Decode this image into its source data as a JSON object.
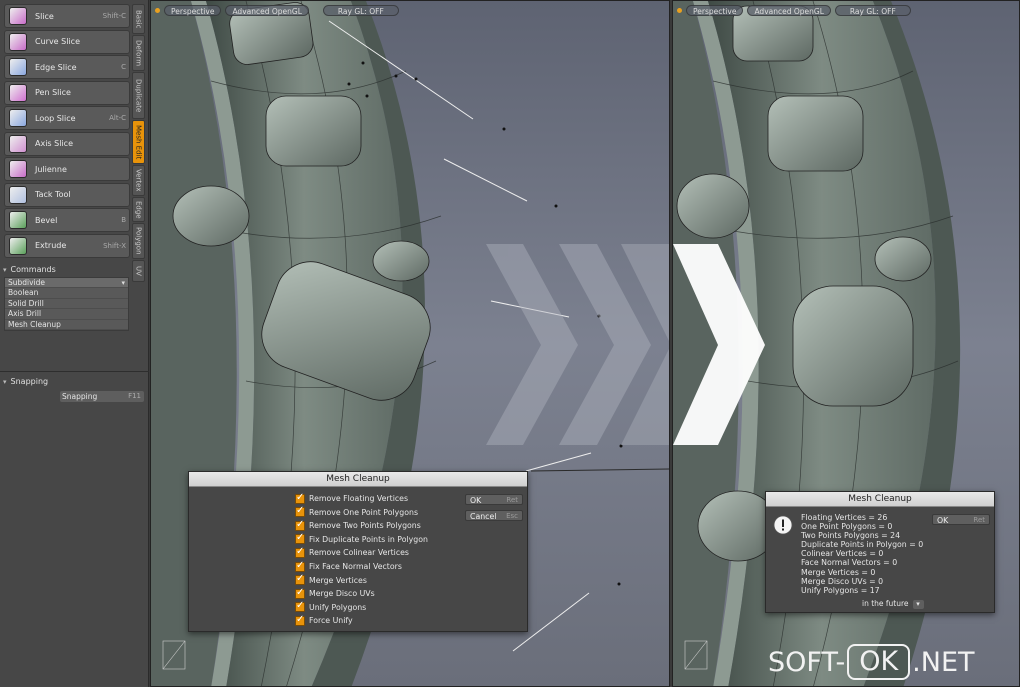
{
  "toolbar": {
    "tools": [
      {
        "label": "Slice",
        "shortcut": "Shift-C",
        "icon": "slice-icon",
        "color": "#c86cc8"
      },
      {
        "label": "Curve Slice",
        "shortcut": "",
        "icon": "curve-slice-icon",
        "color": "#c86cc8"
      },
      {
        "label": "Edge Slice",
        "shortcut": "C",
        "icon": "edge-slice-icon",
        "color": "#8aa8e0"
      },
      {
        "label": "Pen Slice",
        "shortcut": "",
        "icon": "pen-slice-icon",
        "color": "#d070d0"
      },
      {
        "label": "Loop Slice",
        "shortcut": "Alt-C",
        "icon": "loop-slice-icon",
        "color": "#8aa8e0"
      },
      {
        "label": "Axis Slice",
        "shortcut": "",
        "icon": "axis-slice-icon",
        "color": "#d090d0"
      },
      {
        "label": "Julienne",
        "shortcut": "",
        "icon": "julienne-icon",
        "color": "#c86cc8"
      },
      {
        "label": "Tack Tool",
        "shortcut": "",
        "icon": "tack-tool-icon",
        "color": "#b0c0e0"
      },
      {
        "label": "Bevel",
        "shortcut": "B",
        "icon": "bevel-icon",
        "color": "#5aa05a"
      },
      {
        "label": "Extrude",
        "shortcut": "Shift-X",
        "icon": "extrude-icon",
        "color": "#5aa05a"
      }
    ],
    "tabs": [
      "Basic",
      "Deform",
      "Duplicate",
      "Mesh Edit",
      "Vertex",
      "Edge",
      "Polygon",
      "UV"
    ],
    "active_tab": "Mesh Edit"
  },
  "commands": {
    "title": "Commands",
    "items": [
      "Subdivide",
      "Boolean",
      "Solid Drill",
      "Axis Drill",
      "Mesh Cleanup"
    ]
  },
  "snapping": {
    "title": "Snapping",
    "button": "Snapping",
    "shortcut": "F11"
  },
  "viewport_bar": [
    "Perspective",
    "Advanced OpenGL",
    "Ray GL: OFF"
  ],
  "cleanup_dialog": {
    "title": "Mesh Cleanup",
    "options": [
      "Remove Floating Vertices",
      "Remove One Point Polygons",
      "Remove Two Points Polygons",
      "Fix Duplicate Points in Polygon",
      "Remove Colinear Vertices",
      "Fix Face Normal Vectors",
      "Merge Vertices",
      "Merge Disco UVs",
      "Unify Polygons",
      "Force Unify"
    ],
    "ok": "OK",
    "ok_key": "Ret",
    "cancel": "Cancel",
    "cancel_key": "Esc"
  },
  "result_dialog": {
    "title": "Mesh Cleanup",
    "lines": [
      "Floating Vertices = 26",
      "One Point Polygons = 0",
      "Two Points Polygons = 24",
      "Duplicate Points in Polygon = 0",
      "Colinear Vertices = 0",
      "Face Normal Vectors = 0",
      "Merge Vertices = 0",
      "Merge Disco UVs = 0",
      "Unify Polygons = 17"
    ],
    "ok": "OK",
    "ok_key": "Ret",
    "dropdown": "in the future"
  },
  "watermark": {
    "left": "SOFT-",
    "mid": "OK",
    "right": ".NET"
  }
}
